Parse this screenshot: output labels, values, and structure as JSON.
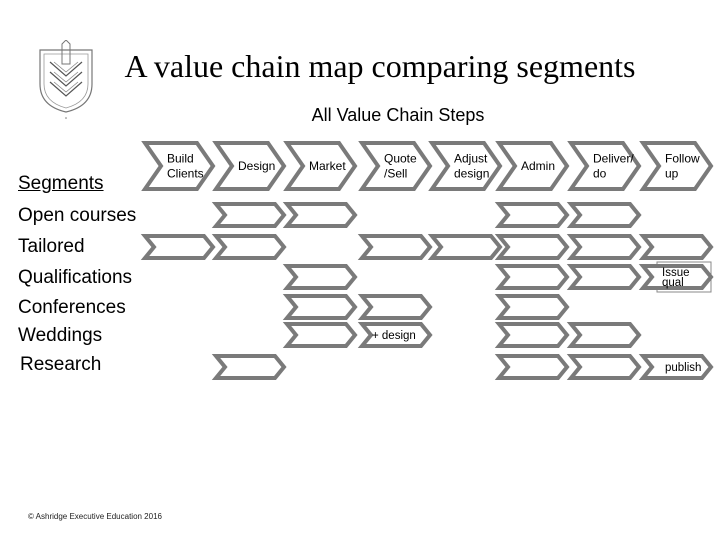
{
  "title": "A value chain map comparing segments",
  "subtitle": "All Value Chain Steps",
  "segments_heading": "Segments",
  "footer": "© Ashridge Executive Education 2016",
  "colors": {
    "arrow_stroke": "#7a7a7a",
    "arrow_fill": "#ffffff",
    "text": "#000000"
  },
  "steps": [
    {
      "id": "build",
      "lines": [
        "Build",
        "Clients"
      ]
    },
    {
      "id": "design",
      "lines": [
        "Design"
      ]
    },
    {
      "id": "market",
      "lines": [
        "Market"
      ]
    },
    {
      "id": "quote",
      "lines": [
        "Quote",
        "/Sell"
      ]
    },
    {
      "id": "adjust",
      "lines": [
        "Adjust",
        "design"
      ]
    },
    {
      "id": "admin",
      "lines": [
        "Admin"
      ]
    },
    {
      "id": "deliver",
      "lines": [
        "Deliver/",
        "do"
      ]
    },
    {
      "id": "follow",
      "lines": [
        "Follow",
        "up"
      ]
    }
  ],
  "segments": [
    {
      "label": "Open courses",
      "cells": [
        {
          "step": "design"
        },
        {
          "step": "market"
        },
        {
          "step": "admin"
        },
        {
          "step": "deliver"
        }
      ]
    },
    {
      "label": "Tailored",
      "cells": [
        {
          "step": "build"
        },
        {
          "step": "design"
        },
        {
          "step": "quote"
        },
        {
          "step": "adjust"
        },
        {
          "step": "admin"
        },
        {
          "step": "deliver"
        },
        {
          "step": "follow"
        }
      ]
    },
    {
      "label": "Qualifications",
      "cells": [
        {
          "step": "market"
        },
        {
          "step": "admin"
        },
        {
          "step": "deliver"
        },
        {
          "step": "follow",
          "note": [
            "Issue",
            "qual"
          ]
        }
      ]
    },
    {
      "label": "Conferences",
      "cells": [
        {
          "step": "market"
        },
        {
          "step": "quote"
        },
        {
          "step": "admin"
        }
      ]
    },
    {
      "label": "Weddings",
      "cells": [
        {
          "step": "market"
        },
        {
          "step": "quote",
          "note": [
            "+ design"
          ]
        },
        {
          "step": "admin"
        },
        {
          "step": "deliver"
        }
      ]
    },
    {
      "label": "Research",
      "cells": [
        {
          "step": "design"
        },
        {
          "step": "admin"
        },
        {
          "step": "deliver"
        },
        {
          "step": "follow",
          "note": [
            "publish"
          ]
        }
      ]
    }
  ]
}
